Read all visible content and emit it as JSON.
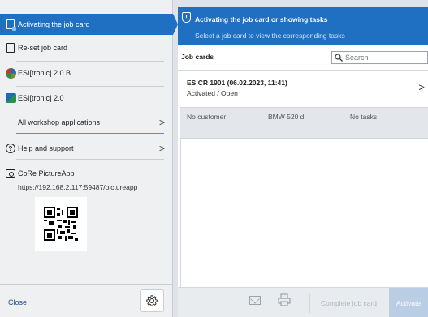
{
  "sidebar": {
    "active_item": {
      "label": "Activating the job card",
      "icon": "document-icon"
    },
    "items": [
      {
        "label": "Re-set job card",
        "icon": "document-icon"
      },
      {
        "label": "ESI[tronic] 2.0 B",
        "icon": "esitronic-b-icon"
      },
      {
        "label": "ESI[tronic] 2.0",
        "icon": "esitronic-icon"
      },
      {
        "label": "All workshop applications",
        "chevron": ">"
      },
      {
        "label": "Help and support",
        "icon": "help-icon",
        "chevron": ">"
      }
    ],
    "picture_app": {
      "label": "CoRe PictureApp",
      "url": "https://192.168.2.117:59487/pictureapp",
      "icon": "camera-icon"
    },
    "close_label": "Close",
    "settings_icon": "gear-icon"
  },
  "main": {
    "banner": {
      "title": "Activating the job card or showing tasks",
      "subtitle": "Select a job card to view the corresponding tasks",
      "color": "#1f6fc2"
    },
    "list": {
      "title": "Job cards",
      "search_placeholder": "Search"
    },
    "job_card": {
      "title": "ES CR 1901 (06.02.2023, 11:41)",
      "status": "Activated / Open",
      "chevron": ">",
      "details": [
        "No customer",
        "BMW 520 d",
        "No tasks"
      ]
    },
    "toolbar": {
      "mail_icon": "mail-icon",
      "print_icon": "print-icon",
      "complete_label": "Complete job card",
      "activate_label": "Activate"
    }
  }
}
